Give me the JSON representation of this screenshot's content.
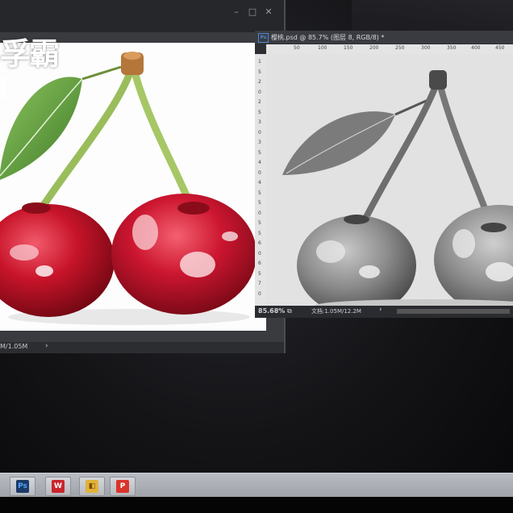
{
  "left_window": {
    "title": "",
    "status_zoom": "M/1.05M",
    "status_arrow": "›"
  },
  "watermark": {
    "text": "孚霸"
  },
  "right_window": {
    "tab_title": "樱桃.psd @ 85.7% (图层 8, RGB/8) *",
    "app_badge": "Ps",
    "ruler_top": [
      "50",
      "100",
      "150",
      "200",
      "250",
      "300",
      "350",
      "400",
      "450"
    ],
    "ruler_left": [
      "1",
      "5",
      "2",
      "0",
      "2",
      "5",
      "3",
      "0",
      "3",
      "5",
      "4",
      "0",
      "4",
      "5",
      "5",
      "0",
      "5",
      "5",
      "6",
      "0",
      "6",
      "5",
      "7",
      "0"
    ],
    "status_zoom": "85.68%",
    "status_doc": "文档:1.05M/12.2M",
    "status_arrow": "›"
  },
  "window_controls": {
    "minimize": "–",
    "maximize": "□",
    "close": "✕"
  },
  "taskbar": {
    "items": [
      {
        "name": "photoshop",
        "glyph": "Ps",
        "color": "#1b3a66",
        "fg": "#4fa3ff"
      },
      {
        "name": "wps-writer",
        "glyph": "W",
        "color": "#c8262b",
        "fg": "#ffffff"
      },
      {
        "name": "image-viewer",
        "glyph": "◧",
        "color": "#e0b23a",
        "fg": "#7a4c00"
      },
      {
        "name": "wps-presentation",
        "glyph": "P",
        "color": "#d9342b",
        "fg": "#ffffff"
      }
    ]
  },
  "colors": {
    "cherry_red": "#c8142a",
    "leaf_green": "#5f9a3c",
    "ps_blue": "#4a88cf"
  }
}
